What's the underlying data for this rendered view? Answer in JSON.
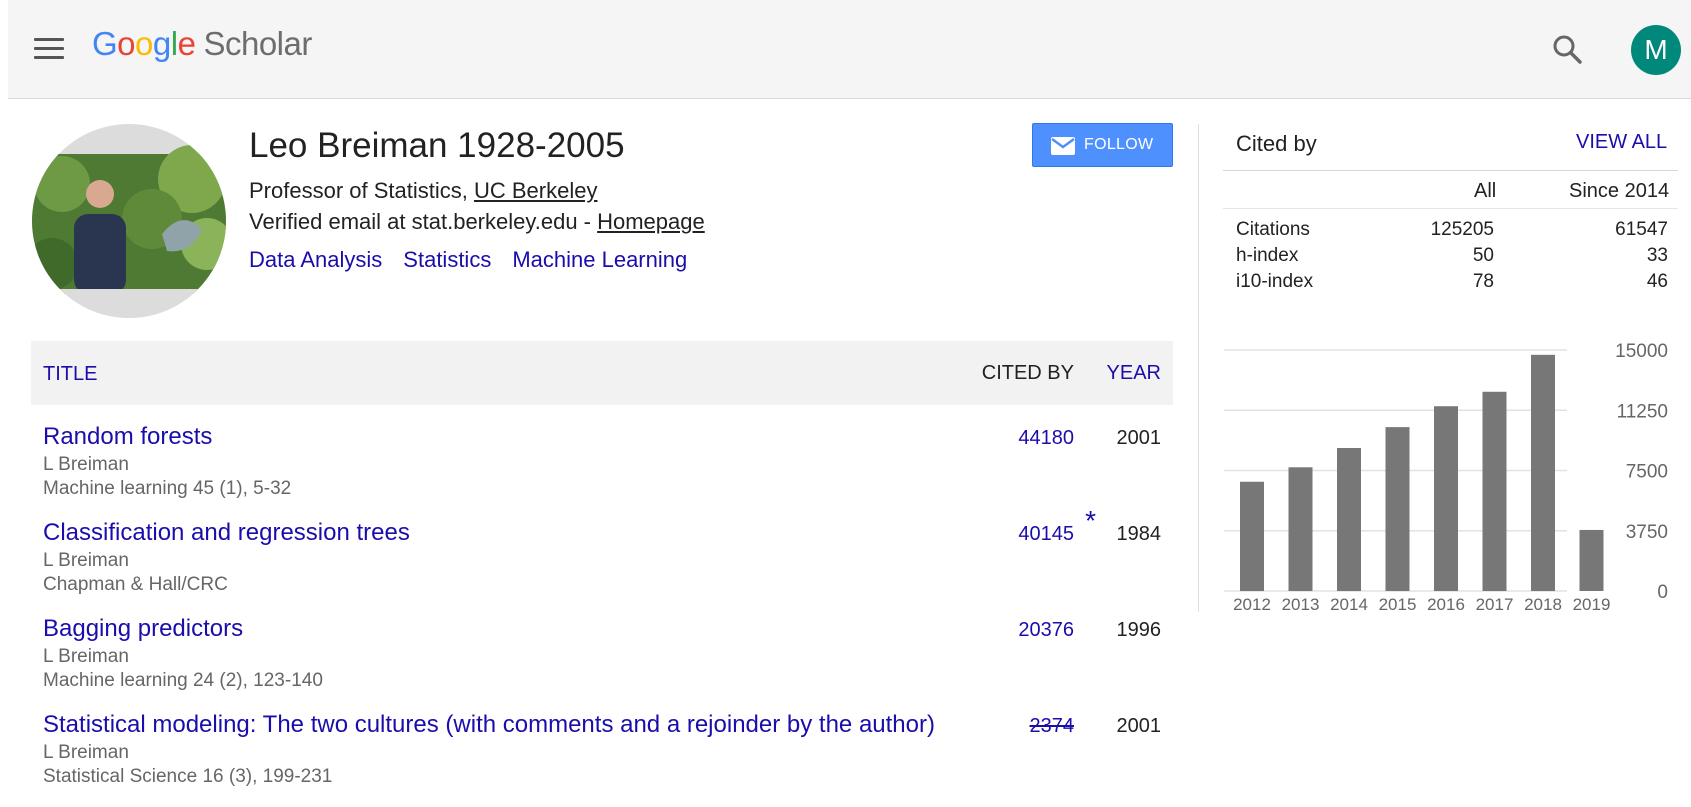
{
  "header": {
    "logo_google": [
      "G",
      "o",
      "o",
      "g",
      "l",
      "e"
    ],
    "logo_product": "Scholar",
    "avatar_initial": "M",
    "icons": [
      "menu-icon",
      "search-icon"
    ]
  },
  "profile": {
    "name": "Leo Breiman 1928-2005",
    "affiliation_prefix": "Professor of Statistics, ",
    "affiliation_link": "UC Berkeley",
    "email_prefix": "Verified email at stat.berkeley.edu - ",
    "homepage_link": "Homepage",
    "interests": [
      "Data Analysis",
      "Statistics",
      "Machine Learning"
    ],
    "follow_label": "FOLLOW"
  },
  "table": {
    "headers": {
      "title": "TITLE",
      "cited_by": "CITED BY",
      "year": "YEAR"
    },
    "rows": [
      {
        "title": "Random forests",
        "authors": "L Breiman",
        "venue": "Machine learning 45 (1), 5-32",
        "cited_by": "44180",
        "year": "2001"
      },
      {
        "title": "Classification and regression trees",
        "authors": "L Breiman",
        "venue": "Chapman & Hall/CRC",
        "cited_by": "40145",
        "star": "*",
        "year": "1984"
      },
      {
        "title": "Bagging predictors",
        "authors": "L Breiman",
        "venue": "Machine learning 24 (2), 123-140",
        "cited_by": "20376",
        "year": "1996"
      },
      {
        "title": "Statistical modeling: The two cultures (with comments and a rejoinder by the author)",
        "authors": "L Breiman",
        "venue": "Statistical Science 16 (3), 199-231",
        "cited_by": "2374",
        "year": "2001"
      }
    ]
  },
  "cited_by": {
    "title": "Cited by",
    "view_all": "VIEW ALL",
    "col_all": "All",
    "col_since": "Since 2014",
    "rows": [
      {
        "label": "Citations",
        "all": "125205",
        "since": "61547"
      },
      {
        "label": "h-index",
        "all": "50",
        "since": "33"
      },
      {
        "label": "i10-index",
        "all": "78",
        "since": "46"
      }
    ]
  },
  "chart_data": {
    "type": "bar",
    "categories": [
      "2012",
      "2013",
      "2014",
      "2015",
      "2016",
      "2017",
      "2018",
      "2019"
    ],
    "values": [
      6800,
      7700,
      8900,
      10200,
      11500,
      12400,
      14700,
      3800
    ],
    "yticks": [
      "0",
      "3750",
      "7500",
      "11250",
      "15000"
    ],
    "ylim": [
      0,
      15000
    ],
    "bar_color": "#777777",
    "grid": true
  }
}
